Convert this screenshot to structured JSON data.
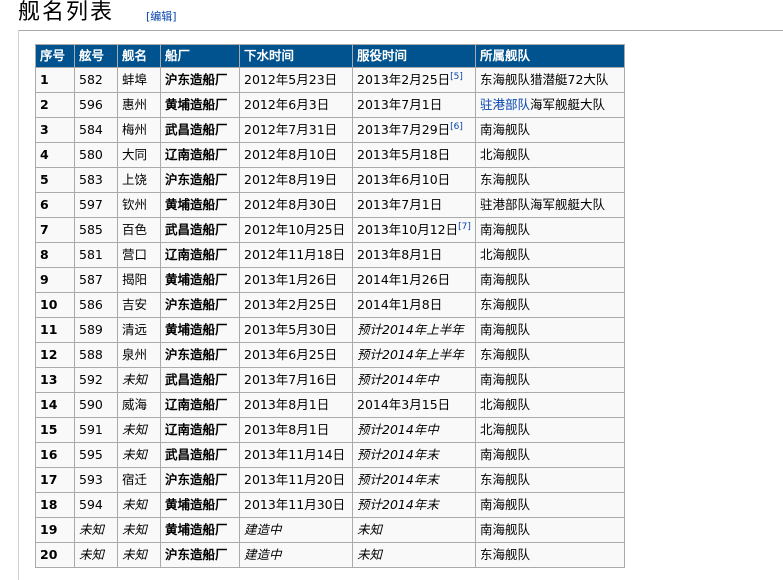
{
  "section": {
    "title": "舰名列表",
    "edit_label": "[编辑]"
  },
  "table": {
    "headers": [
      "序号",
      "舷号",
      "舰名",
      "船厂",
      "下水时间",
      "服役时间",
      "所属舰队"
    ],
    "rows": [
      {
        "no": "1",
        "hull": "582",
        "name": "蚌埠",
        "yard": "沪东造船厂",
        "launch": "2012年5月23日",
        "service": "2013年2月25日",
        "ref": "[5]",
        "fleet_link": "",
        "fleet": "东海舰队猎潜艇72大队"
      },
      {
        "no": "2",
        "hull": "596",
        "name": "惠州",
        "yard": "黄埔造船厂",
        "launch": "2012年6月3日",
        "service": "2013年7月1日",
        "ref": "",
        "fleet_link": "驻港部队",
        "fleet": "海军舰艇大队"
      },
      {
        "no": "3",
        "hull": "584",
        "name": "梅州",
        "yard": "武昌造船厂",
        "launch": "2012年7月31日",
        "service": "2013年7月29日",
        "ref": "[6]",
        "fleet_link": "",
        "fleet": "南海舰队"
      },
      {
        "no": "4",
        "hull": "580",
        "name": "大同",
        "yard": "辽南造船厂",
        "launch": "2012年8月10日",
        "service": "2013年5月18日",
        "ref": "",
        "fleet_link": "",
        "fleet": "北海舰队"
      },
      {
        "no": "5",
        "hull": "583",
        "name": "上饶",
        "yard": "沪东造船厂",
        "launch": "2012年8月19日",
        "service": "2013年6月10日",
        "ref": "",
        "fleet_link": "",
        "fleet": "东海舰队"
      },
      {
        "no": "6",
        "hull": "597",
        "name": "钦州",
        "yard": "黄埔造船厂",
        "launch": "2012年8月30日",
        "service": "2013年7月1日",
        "ref": "",
        "fleet_link": "",
        "fleet": "驻港部队海军舰艇大队"
      },
      {
        "no": "7",
        "hull": "585",
        "name": "百色",
        "yard": "武昌造船厂",
        "launch": "2012年10月25日",
        "service": "2013年10月12日",
        "ref": "[7]",
        "fleet_link": "",
        "fleet": "南海舰队"
      },
      {
        "no": "8",
        "hull": "581",
        "name": "营口",
        "yard": "辽南造船厂",
        "launch": "2012年11月18日",
        "service": "2013年8月1日",
        "ref": "",
        "fleet_link": "",
        "fleet": "北海舰队"
      },
      {
        "no": "9",
        "hull": "587",
        "name": "揭阳",
        "yard": "黄埔造船厂",
        "launch": "2013年1月26日",
        "service": "2014年1月26日",
        "ref": "",
        "fleet_link": "",
        "fleet": "南海舰队"
      },
      {
        "no": "10",
        "hull": "586",
        "name": "吉安",
        "yard": "沪东造船厂",
        "launch": "2013年2月25日",
        "service": "2014年1月8日",
        "ref": "",
        "fleet_link": "",
        "fleet": "东海舰队"
      },
      {
        "no": "11",
        "hull": "589",
        "name": "清远",
        "yard": "黄埔造船厂",
        "launch": "2013年5月30日",
        "service": "预计2014年上半年",
        "ref": "",
        "fleet_link": "",
        "fleet": "南海舰队",
        "service_italic": true
      },
      {
        "no": "12",
        "hull": "588",
        "name": "泉州",
        "yard": "沪东造船厂",
        "launch": "2013年6月25日",
        "service": "预计2014年上半年",
        "ref": "",
        "fleet_link": "",
        "fleet": "东海舰队",
        "service_italic": true
      },
      {
        "no": "13",
        "hull": "592",
        "name": "未知",
        "yard": "武昌造船厂",
        "launch": "2013年7月16日",
        "service": "预计2014年中",
        "ref": "",
        "fleet_link": "",
        "fleet": "南海舰队",
        "name_italic": true,
        "service_italic": true
      },
      {
        "no": "14",
        "hull": "590",
        "name": "威海",
        "yard": "辽南造船厂",
        "launch": "2013年8月1日",
        "service": "2014年3月15日",
        "ref": "",
        "fleet_link": "",
        "fleet": "北海舰队"
      },
      {
        "no": "15",
        "hull": "591",
        "name": "未知",
        "yard": "辽南造船厂",
        "launch": "2013年8月1日",
        "service": "预计2014年中",
        "ref": "",
        "fleet_link": "",
        "fleet": "北海舰队",
        "name_italic": true,
        "service_italic": true
      },
      {
        "no": "16",
        "hull": "595",
        "name": "未知",
        "yard": "武昌造船厂",
        "launch": "2013年11月14日",
        "service": "预计2014年末",
        "ref": "",
        "fleet_link": "",
        "fleet": "南海舰队",
        "name_italic": true,
        "service_italic": true
      },
      {
        "no": "17",
        "hull": "593",
        "name": "宿迁",
        "yard": "沪东造船厂",
        "launch": "2013年11月20日",
        "service": "预计2014年末",
        "ref": "",
        "fleet_link": "",
        "fleet": "东海舰队",
        "service_italic": true
      },
      {
        "no": "18",
        "hull": "594",
        "name": "未知",
        "yard": "黄埔造船厂",
        "launch": "2013年11月30日",
        "service": "预计2014年末",
        "ref": "",
        "fleet_link": "",
        "fleet": "南海舰队",
        "name_italic": true,
        "service_italic": true
      },
      {
        "no": "19",
        "hull": "未知",
        "name": "未知",
        "yard": "黄埔造船厂",
        "launch": "建造中",
        "service": "未知",
        "ref": "",
        "fleet_link": "",
        "fleet": "南海舰队",
        "hull_italic": true,
        "name_italic": true,
        "launch_italic": true,
        "service_italic": true
      },
      {
        "no": "20",
        "hull": "未知",
        "name": "未知",
        "yard": "沪东造船厂",
        "launch": "建造中",
        "service": "未知",
        "ref": "",
        "fleet_link": "",
        "fleet": "东海舰队",
        "hull_italic": true,
        "name_italic": true,
        "launch_italic": true,
        "service_italic": true
      }
    ]
  }
}
